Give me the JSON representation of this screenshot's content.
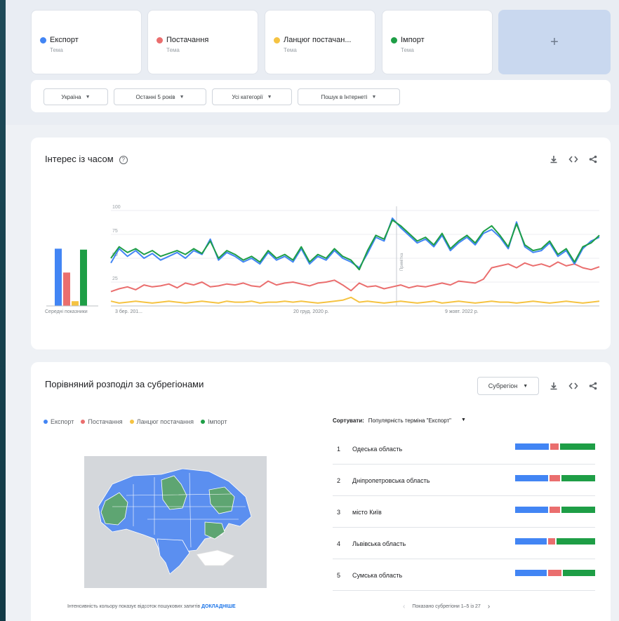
{
  "terms": [
    {
      "name": "Експорт",
      "sub": "Тема",
      "color": "#4285f4"
    },
    {
      "name": "Постачання",
      "sub": "Тема",
      "color": "#ea6e6e"
    },
    {
      "name": "Ланцюг постачан...",
      "sub": "Тема",
      "color": "#f5c342"
    },
    {
      "name": "Імпорт",
      "sub": "Тема",
      "color": "#1e9e46"
    }
  ],
  "add_label": "+",
  "filters": [
    {
      "label": "Україна"
    },
    {
      "label": "Останні 5 років"
    },
    {
      "label": "Усі категорії"
    },
    {
      "label": "Пошук в Інтернеті"
    }
  ],
  "interest": {
    "title": "Інтерес із часом",
    "help": "?",
    "avg_label": "Середні показники",
    "note_label": "Примітка",
    "averages": [
      60,
      35,
      5,
      59
    ]
  },
  "chart_data": {
    "type": "line",
    "title": "Інтерес із часом",
    "ylim": [
      0,
      100
    ],
    "yticks": [
      "100",
      "75",
      "50",
      "25"
    ],
    "xtick_labels": [
      "3 бер. 201...",
      "20 груд. 2020 р.",
      "9 жовт. 2022 р."
    ],
    "x_range": [
      "2019-03",
      "2024-03"
    ],
    "series": [
      {
        "name": "Експорт",
        "color": "#4285f4",
        "values": [
          45,
          60,
          52,
          58,
          50,
          55,
          48,
          52,
          56,
          50,
          58,
          54,
          70,
          48,
          56,
          52,
          46,
          50,
          44,
          56,
          48,
          52,
          46,
          60,
          44,
          52,
          48,
          58,
          50,
          46,
          40,
          55,
          72,
          68,
          92,
          82,
          74,
          66,
          70,
          62,
          74,
          58,
          66,
          72,
          64,
          76,
          80,
          72,
          60,
          88,
          62,
          56,
          58,
          66,
          52,
          58,
          44,
          60,
          68,
          72
        ]
      },
      {
        "name": "Постачання",
        "color": "#ea6e6e",
        "values": [
          15,
          18,
          20,
          17,
          22,
          20,
          21,
          23,
          19,
          24,
          22,
          25,
          20,
          21,
          23,
          22,
          24,
          21,
          20,
          26,
          22,
          24,
          25,
          23,
          21,
          24,
          25,
          27,
          22,
          16,
          24,
          20,
          21,
          18,
          20,
          22,
          19,
          21,
          20,
          22,
          24,
          22,
          26,
          25,
          24,
          28,
          40,
          42,
          44,
          40,
          45,
          42,
          44,
          41,
          46,
          42,
          44,
          40,
          38,
          41
        ]
      },
      {
        "name": "Ланцюг постачання",
        "color": "#f5c342",
        "values": [
          5,
          3,
          4,
          5,
          4,
          3,
          4,
          5,
          4,
          3,
          4,
          5,
          4,
          3,
          5,
          4,
          4,
          5,
          3,
          4,
          4,
          5,
          4,
          5,
          4,
          3,
          4,
          5,
          6,
          9,
          4,
          5,
          4,
          3,
          4,
          5,
          4,
          3,
          4,
          5,
          3,
          4,
          5,
          4,
          3,
          4,
          5,
          4,
          4,
          3,
          4,
          5,
          4,
          3,
          4,
          5,
          4,
          3,
          4,
          5
        ]
      },
      {
        "name": "Імпорт",
        "color": "#1e9e46",
        "values": [
          50,
          62,
          56,
          60,
          54,
          58,
          52,
          55,
          58,
          54,
          60,
          55,
          68,
          50,
          58,
          54,
          48,
          52,
          46,
          58,
          50,
          54,
          48,
          62,
          46,
          54,
          50,
          60,
          52,
          48,
          38,
          58,
          74,
          70,
          90,
          84,
          76,
          68,
          72,
          64,
          76,
          60,
          68,
          74,
          66,
          78,
          84,
          74,
          62,
          86,
          64,
          58,
          60,
          68,
          54,
          60,
          46,
          62,
          66,
          74
        ]
      }
    ]
  },
  "regions_panel": {
    "title": "Порівняний розподіл за субрегіонами",
    "dropdown": "Субрегіон",
    "legend": [
      "Експорт",
      "Постачання",
      "Ланцюг постачання",
      "Імпорт"
    ],
    "sort_label": "Сортувати:",
    "sort_value": "Популярність терміна \"Експорт\"",
    "rows": [
      {
        "num": "1",
        "name": "Одеська область",
        "shares": [
          44,
          11,
          0,
          45
        ]
      },
      {
        "num": "2",
        "name": "Дніпропетровська область",
        "shares": [
          43,
          13,
          0,
          44
        ]
      },
      {
        "num": "3",
        "name": "місто Київ",
        "shares": [
          43,
          13,
          0,
          44
        ]
      },
      {
        "num": "4",
        "name": "Львівська область",
        "shares": [
          41,
          9,
          0,
          50
        ]
      },
      {
        "num": "5",
        "name": "Сумська область",
        "shares": [
          41,
          17,
          0,
          42
        ]
      }
    ],
    "footnote": "Інтенсивність кольору показує відсоток пошукових запитів",
    "footnote_link": "ДОКЛАДНІШЕ",
    "pager": "Показано субрегіони 1–5 із 27"
  }
}
